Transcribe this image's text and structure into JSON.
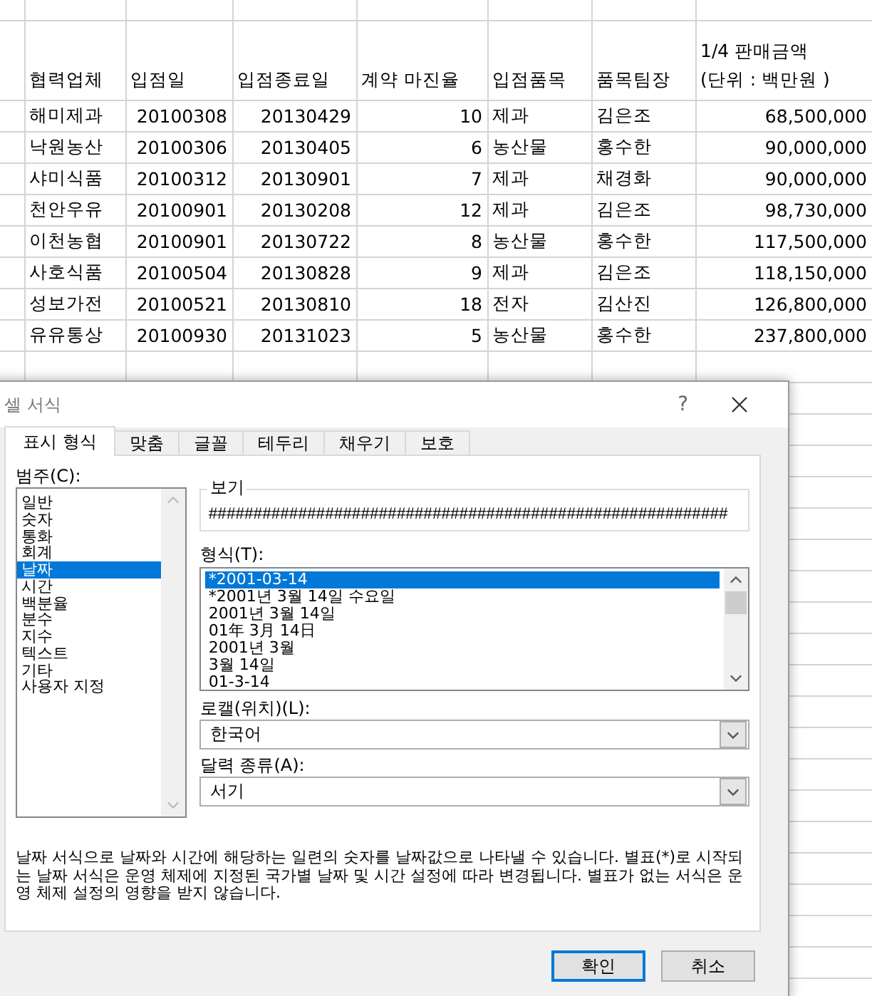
{
  "sheet": {
    "columns": [
      {
        "label": "협력업체",
        "kind": "text"
      },
      {
        "label": "입점일",
        "kind": "number"
      },
      {
        "label": "입점종료일",
        "kind": "number"
      },
      {
        "label": "계약 마진율",
        "kind": "number"
      },
      {
        "label": "입점품목",
        "kind": "text"
      },
      {
        "label": "품목팀장",
        "kind": "text"
      },
      {
        "label": "1/4 판매금액\n(단위 : 백만원 )",
        "kind": "number"
      }
    ],
    "rows": [
      [
        "해미제과",
        "20100308",
        "20130429",
        "10",
        "제과",
        "김은조",
        "68,500,000"
      ],
      [
        "낙원농산",
        "20100306",
        "20130405",
        "6",
        "농산물",
        "홍수한",
        "90,000,000"
      ],
      [
        "샤미식품",
        "20100312",
        "20130901",
        "7",
        "제과",
        "채경화",
        "90,000,000"
      ],
      [
        "천안우유",
        "20100901",
        "20130208",
        "12",
        "제과",
        "김은조",
        "98,730,000"
      ],
      [
        "이천농협",
        "20100901",
        "20130722",
        "8",
        "농산물",
        "홍수한",
        "117,500,000"
      ],
      [
        "사호식품",
        "20100504",
        "20130828",
        "9",
        "제과",
        "김은조",
        "118,150,000"
      ],
      [
        "성보가전",
        "20100521",
        "20130810",
        "18",
        "전자",
        "김산진",
        "126,800,000"
      ],
      [
        "유유통상",
        "20100930",
        "20131023",
        "5",
        "농산물",
        "홍수한",
        "237,800,000"
      ]
    ]
  },
  "dialog": {
    "title": "셀 서식",
    "help": "?",
    "tabs": [
      {
        "label": "표시 형식",
        "selected": true
      },
      {
        "label": "맞춤",
        "selected": false
      },
      {
        "label": "글꼴",
        "selected": false
      },
      {
        "label": "테두리",
        "selected": false
      },
      {
        "label": "채우기",
        "selected": false
      },
      {
        "label": "보호",
        "selected": false
      }
    ],
    "category_label": "범주(C):",
    "categories": [
      {
        "label": "일반",
        "selected": false
      },
      {
        "label": "숫자",
        "selected": false
      },
      {
        "label": "통화",
        "selected": false
      },
      {
        "label": "회계",
        "selected": false
      },
      {
        "label": "날짜",
        "selected": true
      },
      {
        "label": "시간",
        "selected": false
      },
      {
        "label": "백분율",
        "selected": false
      },
      {
        "label": "분수",
        "selected": false
      },
      {
        "label": "지수",
        "selected": false
      },
      {
        "label": "텍스트",
        "selected": false
      },
      {
        "label": "기타",
        "selected": false
      },
      {
        "label": "사용자 지정",
        "selected": false
      }
    ],
    "preview_label": "보기",
    "preview_value": "##########################################################",
    "format_label": "형식(T):",
    "formats": [
      {
        "label": "*2001-03-14",
        "selected": true
      },
      {
        "label": "*2001년 3월 14일 수요일",
        "selected": false
      },
      {
        "label": "2001년 3월 14일",
        "selected": false
      },
      {
        "label": "01年 3月 14日",
        "selected": false
      },
      {
        "label": "2001년 3월",
        "selected": false
      },
      {
        "label": "3월 14일",
        "selected": false
      },
      {
        "label": "01-3-14",
        "selected": false
      }
    ],
    "locale_label": "로캘(위치)(L):",
    "locale_value": "한국어",
    "calendar_label": "달력 종류(A):",
    "calendar_value": "서기",
    "description": "날짜 서식으로 날짜와 시간에 해당하는 일련의 숫자를 날짜값으로 나타낼 수 있습니다. 별표(*)로 시작되는 날짜 서식은 운영 체제에 지정된 국가별 날짜 및 시간 설정에 따라 변경됩니다. 별표가 없는 서식은 운영 체제 설정의 영향을 받지 않습니다.",
    "buttons": [
      {
        "label": "확인",
        "default": true
      },
      {
        "label": "취소",
        "default": false
      }
    ]
  }
}
